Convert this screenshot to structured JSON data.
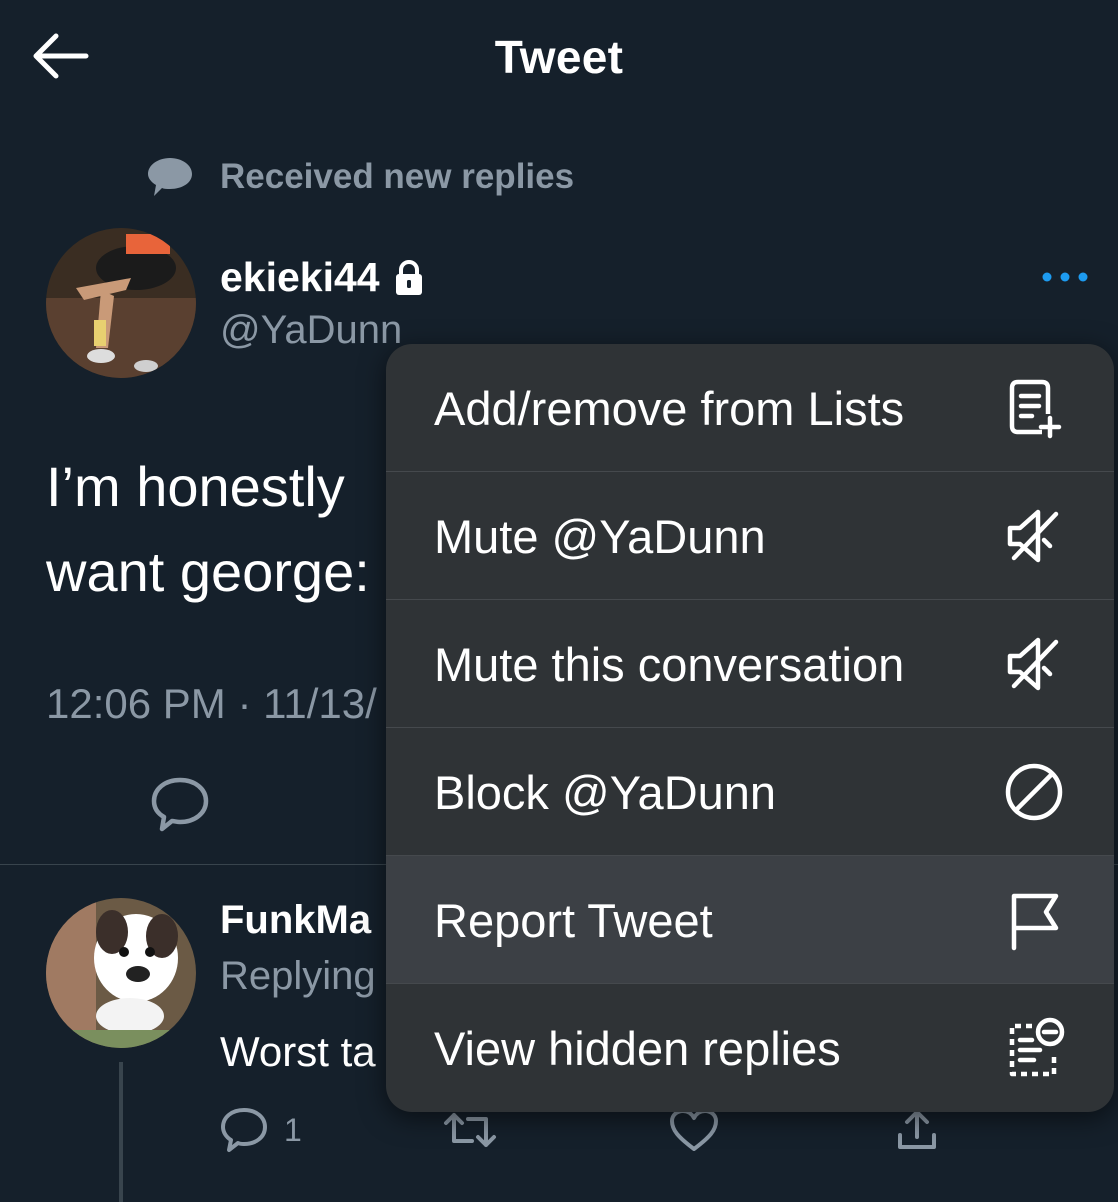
{
  "header": {
    "title": "Tweet",
    "back_icon": "arrow-left-icon"
  },
  "notice": {
    "text": "Received new replies",
    "icon": "speech-bubble-icon"
  },
  "tweet": {
    "display_name": "ekieki44",
    "handle": "@YaDunn",
    "protected_icon": "lock-icon",
    "more_icon": "more-dots-icon",
    "body_lines": [
      "I’m honestly",
      "want george:"
    ],
    "timestamp": "12:06 PM · 11/13/"
  },
  "reply": {
    "display_name": "FunkMa",
    "replying": "Replying",
    "text": "Worst ta",
    "reply_count": "1"
  },
  "menu": {
    "items": [
      {
        "label": "Add/remove from Lists",
        "icon": "list-add-icon"
      },
      {
        "label": "Mute @YaDunn",
        "icon": "speaker-mute-icon"
      },
      {
        "label": "Mute this conversation",
        "icon": "speaker-mute-icon"
      },
      {
        "label": "Block @YaDunn",
        "icon": "block-icon"
      },
      {
        "label": "Report Tweet",
        "icon": "flag-icon"
      },
      {
        "label": "View hidden replies",
        "icon": "hidden-replies-icon"
      }
    ]
  },
  "colors": {
    "background": "#15202b",
    "secondary_text": "#8b98a5",
    "accent": "#1d9bf0",
    "menu_bg": "#2f3336"
  }
}
